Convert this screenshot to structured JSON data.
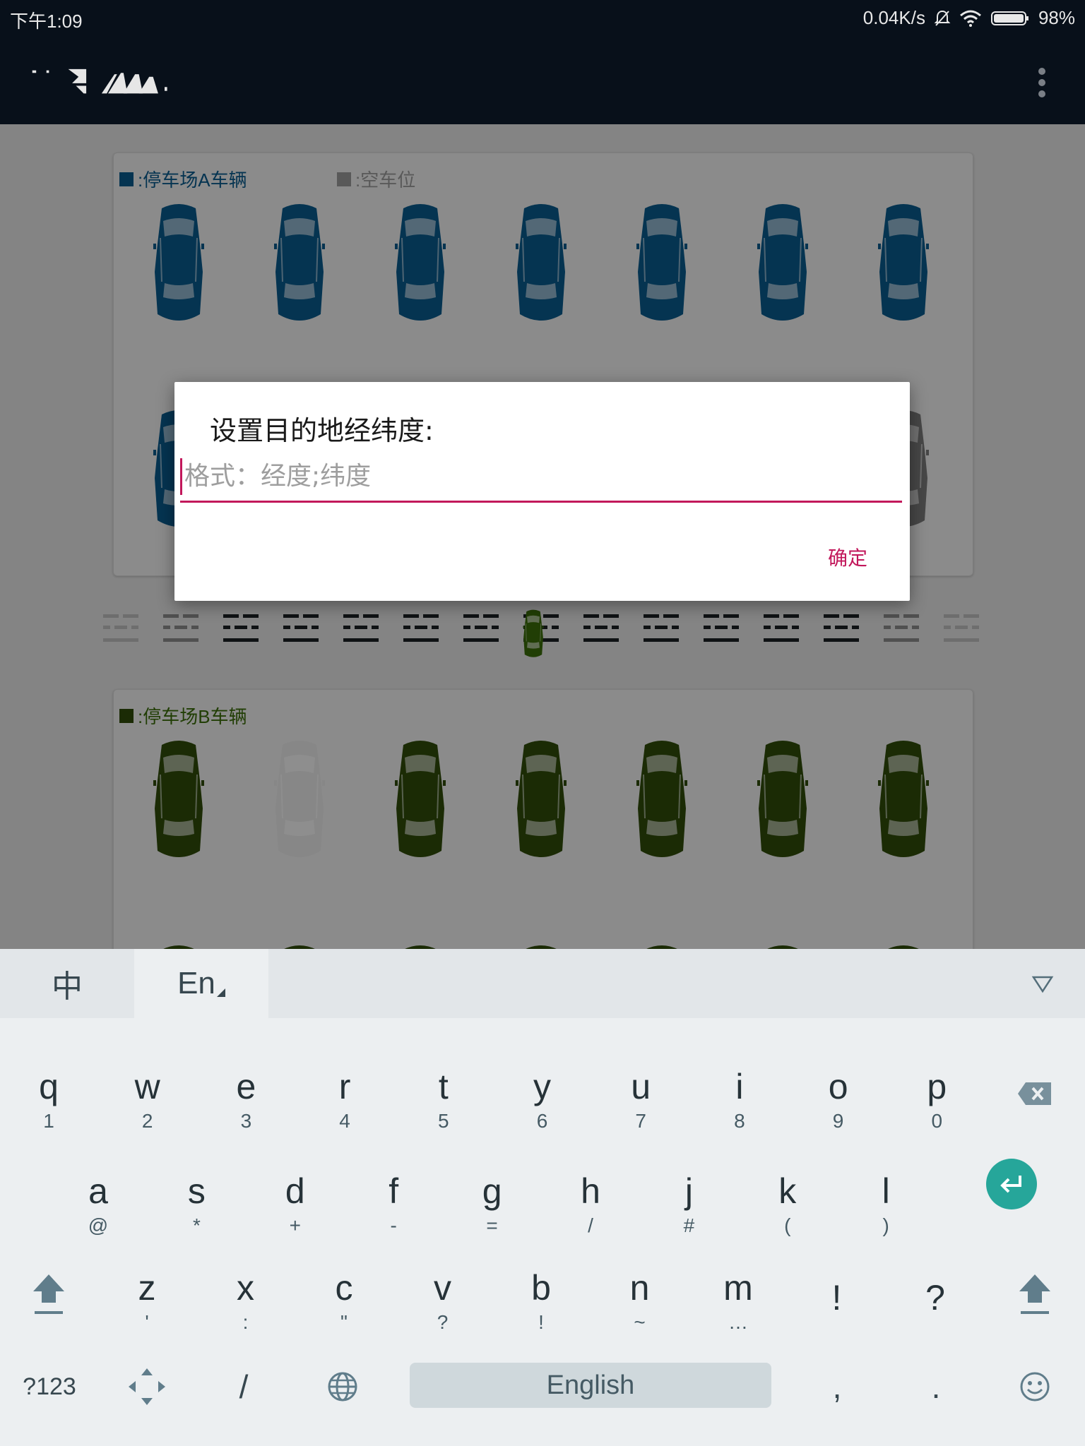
{
  "status_bar": {
    "time": "下午1:09",
    "net_speed": "0.04K/s",
    "battery": "98%"
  },
  "lot_a": {
    "legend_vehicles": ":停车场A车辆",
    "legend_empty": ":空车位"
  },
  "lot_b": {
    "legend_vehicles": ":停车场B车辆"
  },
  "dialog": {
    "title": "设置目的地经纬度:",
    "input_placeholder": "格式：经度;纬度",
    "input_value": "",
    "confirm_label": "确定"
  },
  "keyboard": {
    "tab_chinese": "中",
    "tab_english": "En",
    "row1": [
      {
        "k": "q",
        "s": "1"
      },
      {
        "k": "w",
        "s": "2"
      },
      {
        "k": "e",
        "s": "3"
      },
      {
        "k": "r",
        "s": "4"
      },
      {
        "k": "t",
        "s": "5"
      },
      {
        "k": "y",
        "s": "6"
      },
      {
        "k": "u",
        "s": "7"
      },
      {
        "k": "i",
        "s": "8"
      },
      {
        "k": "o",
        "s": "9"
      },
      {
        "k": "p",
        "s": "0"
      }
    ],
    "row2": [
      {
        "k": "a",
        "s": "@"
      },
      {
        "k": "s",
        "s": "*"
      },
      {
        "k": "d",
        "s": "+"
      },
      {
        "k": "f",
        "s": "-"
      },
      {
        "k": "g",
        "s": "="
      },
      {
        "k": "h",
        "s": "/"
      },
      {
        "k": "j",
        "s": "#"
      },
      {
        "k": "k",
        "s": "("
      },
      {
        "k": "l",
        "s": ")"
      }
    ],
    "row3": [
      {
        "k": "z",
        "s": "'"
      },
      {
        "k": "x",
        "s": ":"
      },
      {
        "k": "c",
        "s": "\""
      },
      {
        "k": "v",
        "s": "?"
      },
      {
        "k": "b",
        "s": "!"
      },
      {
        "k": "n",
        "s": "~"
      },
      {
        "k": "m",
        "s": "…"
      },
      {
        "k": "!",
        "s": ""
      },
      {
        "k": "?",
        "s": ""
      }
    ],
    "symbols_label": "?123",
    "slash_label": "/",
    "space_label": "English",
    "comma_label": ",",
    "period_label": "."
  },
  "colors": {
    "lot_a_car": "#0a5a8c",
    "lot_b_car": "#2f4a0a",
    "accent": "#c2185b",
    "enter_key": "#26a69a"
  }
}
